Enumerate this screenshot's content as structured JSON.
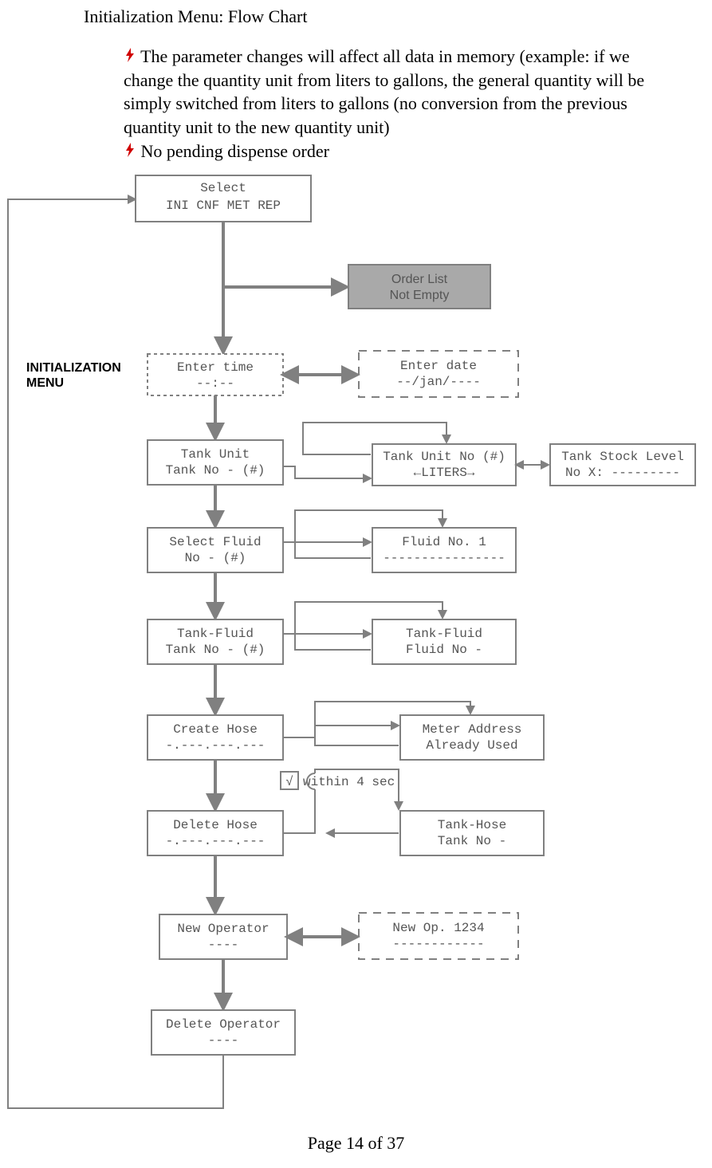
{
  "title": "Initialization Menu: Flow Chart",
  "warning1": "The parameter changes will affect all data in memory (example: if we change the quantity unit from liters to gallons, the general quantity will be simply switched from liters to gallons (no conversion from the previous quantity unit to the new quantity unit)",
  "warning2": "No pending dispense order",
  "sidelabel_l1": "INITIALIZATION",
  "sidelabel_l2": "MENU",
  "footer": "Page 14 of 37",
  "chart_data": {
    "type": "flowchart",
    "nodes": [
      {
        "id": "select",
        "line1": "Select",
        "line2": "INI   CNF   MET   REP",
        "style": "solid"
      },
      {
        "id": "orderlist",
        "line1": "Order List",
        "line2": "Not Empty",
        "style": "filled"
      },
      {
        "id": "entertime",
        "line1": "Enter time",
        "line2": "--:--",
        "style": "dashed-small"
      },
      {
        "id": "enterdate",
        "line1": "Enter date",
        "line2": "--/jan/----",
        "style": "dashed-large"
      },
      {
        "id": "tankunit",
        "line1": "Tank Unit",
        "line2": "Tank No - (#)",
        "style": "solid"
      },
      {
        "id": "tankunitno",
        "line1": "Tank Unit No (#)",
        "line2": "←LITERS→",
        "style": "solid"
      },
      {
        "id": "tankstock",
        "line1": "Tank Stock Level",
        "line2": "No X: ---------",
        "style": "solid"
      },
      {
        "id": "selectfluid",
        "line1": "Select Fluid",
        "line2": "No - (#)",
        "style": "solid"
      },
      {
        "id": "fluidno1",
        "line1": "Fluid No. 1",
        "line2": "----------------",
        "style": "solid"
      },
      {
        "id": "tankfluid",
        "line1": "Tank-Fluid",
        "line2": "Tank No - (#)",
        "style": "solid"
      },
      {
        "id": "tankfluidno",
        "line1": "Tank-Fluid",
        "line2": "Fluid No -",
        "style": "solid"
      },
      {
        "id": "createhose",
        "line1": "Create Hose",
        "line2": "-.---.---.---",
        "style": "solid"
      },
      {
        "id": "meteraddr",
        "line1": "Meter Address",
        "line2": "Already Used",
        "style": "solid"
      },
      {
        "id": "within4",
        "label": "√ within 4 sec.",
        "style": "inline-check"
      },
      {
        "id": "deletehose",
        "line1": "Delete Hose",
        "line2": "-.---.---.---",
        "style": "solid"
      },
      {
        "id": "tankhose",
        "line1": "Tank-Hose",
        "line2": "Tank No -",
        "style": "solid"
      },
      {
        "id": "newop",
        "line1": "New Operator",
        "line2": "----",
        "style": "solid"
      },
      {
        "id": "newop1234",
        "line1": "New Op. 1234",
        "line2": "------------",
        "style": "dashed-large"
      },
      {
        "id": "delop",
        "line1": "Delete Operator",
        "line2": "----",
        "style": "solid"
      }
    ],
    "edges": [
      {
        "from": "select",
        "to": "orderlist"
      },
      {
        "from": "select",
        "to": "entertime"
      },
      {
        "from": "entertime",
        "to": "enterdate",
        "bidir": true
      },
      {
        "from": "entertime",
        "to": "tankunit"
      },
      {
        "from": "tankunit",
        "to": "tankunitno",
        "bidir": true
      },
      {
        "from": "tankunitno",
        "to": "tankstock",
        "bidir": true
      },
      {
        "from": "tankunit",
        "to": "selectfluid"
      },
      {
        "from": "selectfluid",
        "to": "fluidno1",
        "bidir": true
      },
      {
        "from": "selectfluid",
        "to": "tankfluid"
      },
      {
        "from": "tankfluid",
        "to": "tankfluidno",
        "bidir": true
      },
      {
        "from": "tankfluid",
        "to": "createhose"
      },
      {
        "from": "createhose",
        "to": "meteraddr",
        "bidir": true
      },
      {
        "from": "createhose",
        "to": "deletehose"
      },
      {
        "from": "deletehose",
        "to": "tankhose",
        "bidir": true
      },
      {
        "from": "deletehose",
        "to": "newop"
      },
      {
        "from": "newop",
        "to": "newop1234",
        "bidir": true
      },
      {
        "from": "newop",
        "to": "delop"
      },
      {
        "from": "delop",
        "to": "select",
        "note": "loop-back left spine"
      }
    ]
  }
}
